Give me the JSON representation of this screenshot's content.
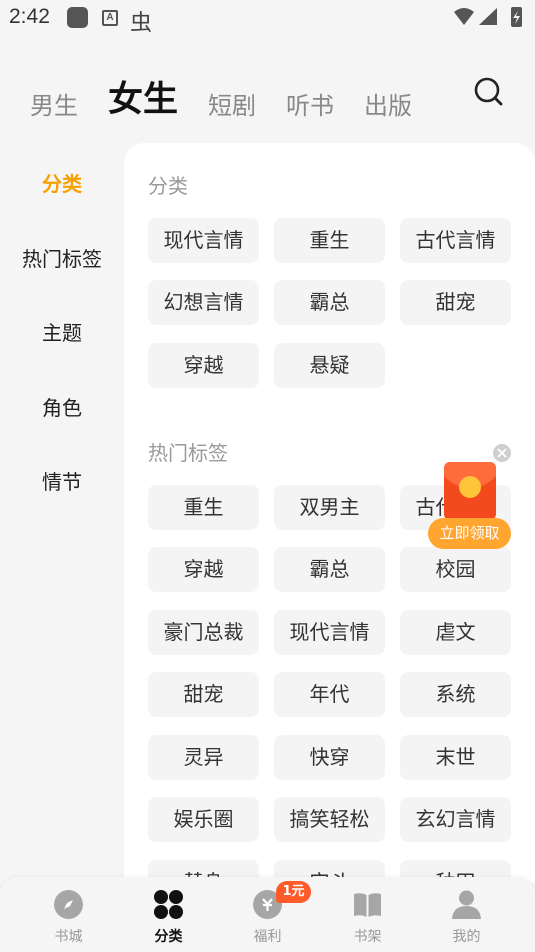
{
  "status": {
    "time": "2:42"
  },
  "top_tabs": [
    {
      "label": "男生"
    },
    {
      "label": "女生"
    },
    {
      "label": "短剧"
    },
    {
      "label": "听书"
    },
    {
      "label": "出版"
    }
  ],
  "sidebar": {
    "items": [
      {
        "label": "分类"
      },
      {
        "label": "热门标签"
      },
      {
        "label": "主题"
      },
      {
        "label": "角色"
      },
      {
        "label": "情节"
      }
    ]
  },
  "sections": {
    "category": {
      "title": "分类",
      "items": [
        "现代言情",
        "重生",
        "古代言情",
        "幻想言情",
        "霸总",
        "甜宠",
        "穿越",
        "悬疑"
      ]
    },
    "hot_tags": {
      "title": "热门标签",
      "items": [
        "重生",
        "双男主",
        "古代言情",
        "穿越",
        "霸总",
        "校园",
        "豪门总裁",
        "现代言情",
        "虐文",
        "甜宠",
        "年代",
        "系统",
        "灵异",
        "快穿",
        "末世",
        "娱乐圈",
        "搞笑轻松",
        "玄幻言情",
        "替身",
        "宫斗",
        "种田"
      ]
    }
  },
  "floating_promo": {
    "label": "立即领取"
  },
  "bottom_nav": {
    "items": [
      {
        "label": "书城",
        "icon": "compass-icon"
      },
      {
        "label": "分类",
        "icon": "grid-icon"
      },
      {
        "label": "福利",
        "icon": "gift-icon",
        "badge": "1元"
      },
      {
        "label": "书架",
        "icon": "book-icon"
      },
      {
        "label": "我的",
        "icon": "person-icon"
      }
    ]
  },
  "colors": {
    "accent": "#f5a000",
    "promo": "#ffa530",
    "badge": "#ff5a2a"
  }
}
